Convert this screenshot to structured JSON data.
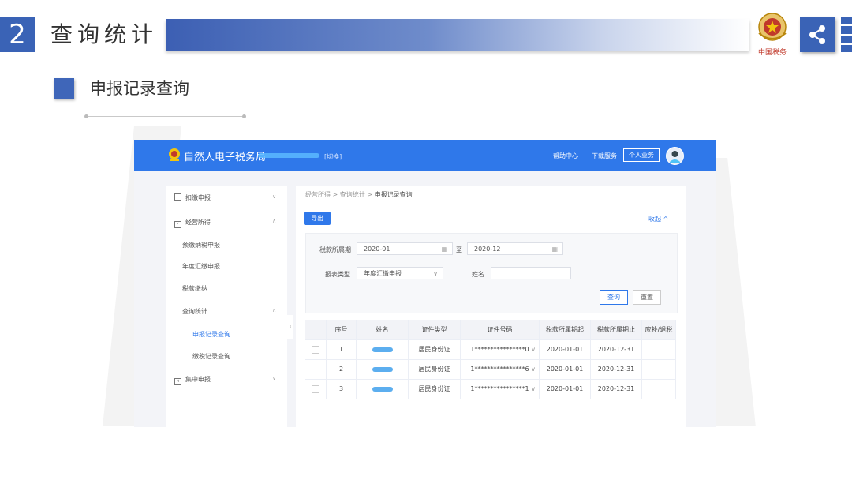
{
  "slide": {
    "section_number": "2",
    "section_title": "查询统计",
    "subtitle": "申报记录查询",
    "emblem_text": "中国税务"
  },
  "app": {
    "site_name": "自然人电子税务局",
    "switch_label": "[切换]",
    "help_label": "帮助中心",
    "download_label": "下载服务",
    "personal_label": "个人业务"
  },
  "sidebar": {
    "items": [
      {
        "label": "扣缴申报"
      },
      {
        "label": "经营所得"
      },
      {
        "label": "预缴纳税申报"
      },
      {
        "label": "年度汇缴申报"
      },
      {
        "label": "税款缴纳"
      },
      {
        "label": "查询统计"
      },
      {
        "label": "申报记录查询"
      },
      {
        "label": "缴税记录查询"
      },
      {
        "label": "集中申报"
      }
    ]
  },
  "main": {
    "breadcrumb": [
      "经营所得",
      "查询统计",
      "申报记录查询"
    ],
    "export_label": "导出",
    "collapse_label": "收起 ^",
    "filter": {
      "period_label": "税款所属期",
      "period_start": "2020-01",
      "to_label": "至",
      "period_end": "2020-12",
      "report_type_label": "报表类型",
      "report_type_value": "年度汇缴申报",
      "name_label": "姓名",
      "name_value": "",
      "query_label": "查询",
      "reset_label": "重置"
    },
    "table": {
      "headers": [
        "序号",
        "姓名",
        "证件类型",
        "证件号码",
        "税款所属期起",
        "税款所属期止",
        "应补/退税"
      ],
      "rows": [
        {
          "no": "1",
          "id_type": "居民身份证",
          "id_number": "1****************0",
          "start": "2020-01-01",
          "end": "2020-12-31"
        },
        {
          "no": "2",
          "id_type": "居民身份证",
          "id_number": "1****************6",
          "start": "2020-01-01",
          "end": "2020-12-31"
        },
        {
          "no": "3",
          "id_type": "居民身份证",
          "id_number": "1****************1",
          "start": "2020-01-01",
          "end": "2020-12-31"
        }
      ]
    }
  },
  "colors": {
    "brand_blue": "#2f78ea",
    "slide_blue": "#3a63b6"
  }
}
